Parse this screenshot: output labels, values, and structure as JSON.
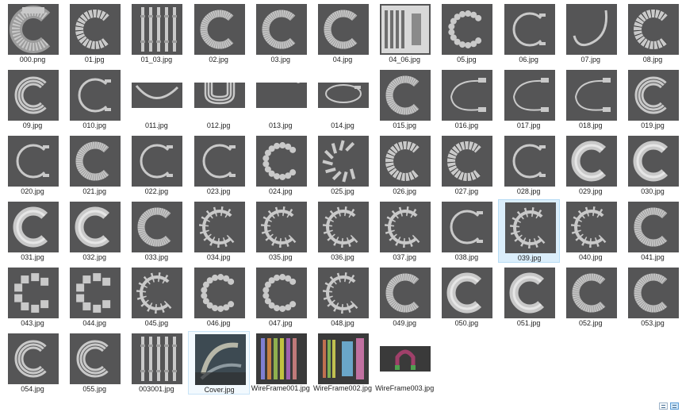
{
  "files": [
    {
      "name": "000.png",
      "icon": "cable-bundle-thumbnail",
      "shape": "bundle"
    },
    {
      "name": "01.jpg",
      "icon": "segmented-cable-thumbnail",
      "shape": "segments"
    },
    {
      "name": "01_03.jpg",
      "icon": "straight-cables-thumbnail",
      "shape": "straight"
    },
    {
      "name": "02.jpg",
      "icon": "ribbed-tube-thumbnail",
      "shape": "ribbed"
    },
    {
      "name": "03.jpg",
      "icon": "ribbed-tube-thumbnail",
      "shape": "ribbed"
    },
    {
      "name": "04.jpg",
      "icon": "ribbed-tube-thumbnail",
      "shape": "ribbed"
    },
    {
      "name": "04_06.jpg",
      "icon": "cable-sheet-thumbnail",
      "shape": "sheet"
    },
    {
      "name": "05.jpg",
      "icon": "bead-chain-thumbnail",
      "shape": "beads"
    },
    {
      "name": "06.jpg",
      "icon": "thin-wire-thumbnail",
      "shape": "wire"
    },
    {
      "name": "07.jpg",
      "icon": "curved-wire-thumbnail",
      "shape": "wirehook"
    },
    {
      "name": "08.jpg",
      "icon": "segmented-cable-thumbnail",
      "shape": "segments"
    },
    {
      "name": "09.jpg",
      "icon": "multi-tube-thumbnail",
      "shape": "multitube"
    },
    {
      "name": "010.jpg",
      "icon": "thin-wire-thumbnail",
      "shape": "wire"
    },
    {
      "name": "011.jpg",
      "icon": "thin-wire-thumbnail",
      "shape": "wide-wire"
    },
    {
      "name": "012.jpg",
      "icon": "multi-tube-thumbnail",
      "shape": "wide-multi"
    },
    {
      "name": "013.jpg",
      "icon": "bead-chain-thumbnail",
      "shape": "wide-beads"
    },
    {
      "name": "014.jpg",
      "icon": "wire-loop-thumbnail",
      "shape": "wide-loop"
    },
    {
      "name": "015.jpg",
      "icon": "ribbed-tube-thumbnail",
      "shape": "ribbed"
    },
    {
      "name": "016.jpg",
      "icon": "wire-loop-thumbnail",
      "shape": "loop"
    },
    {
      "name": "017.jpg",
      "icon": "wire-loop-thumbnail",
      "shape": "loop"
    },
    {
      "name": "018.jpg",
      "icon": "wire-loop-thumbnail",
      "shape": "loop"
    },
    {
      "name": "019.jpg",
      "icon": "multi-tube-thumbnail",
      "shape": "multitube"
    },
    {
      "name": "020.jpg",
      "icon": "thin-wire-thumbnail",
      "shape": "wire"
    },
    {
      "name": "021.jpg",
      "icon": "ribbed-tube-thumbnail",
      "shape": "ribbed"
    },
    {
      "name": "022.jpg",
      "icon": "thin-wire-thumbnail",
      "shape": "wire"
    },
    {
      "name": "023.jpg",
      "icon": "thin-wire-thumbnail",
      "shape": "wire"
    },
    {
      "name": "024.jpg",
      "icon": "bead-chain-thumbnail",
      "shape": "beads"
    },
    {
      "name": "025.jpg",
      "icon": "twisted-cable-thumbnail",
      "shape": "twisted"
    },
    {
      "name": "026.jpg",
      "icon": "segmented-cable-thumbnail",
      "shape": "segments"
    },
    {
      "name": "027.jpg",
      "icon": "segmented-cable-thumbnail",
      "shape": "segments"
    },
    {
      "name": "028.jpg",
      "icon": "thin-wire-thumbnail",
      "shape": "wire"
    },
    {
      "name": "029.jpg",
      "icon": "smooth-tube-thumbnail",
      "shape": "smooth"
    },
    {
      "name": "030.jpg",
      "icon": "smooth-tube-thumbnail",
      "shape": "smooth"
    },
    {
      "name": "031.jpg",
      "icon": "smooth-tube-thumbnail",
      "shape": "smooth"
    },
    {
      "name": "032.jpg",
      "icon": "smooth-tube-thumbnail",
      "shape": "smooth"
    },
    {
      "name": "033.jpg",
      "icon": "ribbed-tube-thumbnail",
      "shape": "ribbed"
    },
    {
      "name": "034.jpg",
      "icon": "framed-cable-thumbnail",
      "shape": "framed"
    },
    {
      "name": "035.jpg",
      "icon": "framed-cable-thumbnail",
      "shape": "framed"
    },
    {
      "name": "036.jpg",
      "icon": "framed-cable-thumbnail",
      "shape": "framed"
    },
    {
      "name": "037.jpg",
      "icon": "framed-cable-thumbnail",
      "shape": "framed"
    },
    {
      "name": "038.jpg",
      "icon": "thin-wire-thumbnail",
      "shape": "wire"
    },
    {
      "name": "039.jpg",
      "icon": "framed-cable-thumbnail",
      "shape": "framed",
      "selected": true
    },
    {
      "name": "040.jpg",
      "icon": "framed-cable-thumbnail",
      "shape": "framed"
    },
    {
      "name": "041.jpg",
      "icon": "ribbed-tube-thumbnail",
      "shape": "ribbed"
    },
    {
      "name": "043.jpg",
      "icon": "block-chain-thumbnail",
      "shape": "blocks"
    },
    {
      "name": "044.jpg",
      "icon": "block-chain-thumbnail",
      "shape": "blocks"
    },
    {
      "name": "045.jpg",
      "icon": "framed-cable-thumbnail",
      "shape": "framed"
    },
    {
      "name": "046.jpg",
      "icon": "bead-chain-thumbnail",
      "shape": "beads"
    },
    {
      "name": "047.jpg",
      "icon": "bead-chain-thumbnail",
      "shape": "beads"
    },
    {
      "name": "048.jpg",
      "icon": "framed-cable-thumbnail",
      "shape": "framed"
    },
    {
      "name": "049.jpg",
      "icon": "ribbed-tube-thumbnail",
      "shape": "ribbed"
    },
    {
      "name": "050.jpg",
      "icon": "smooth-tube-thumbnail",
      "shape": "smooth"
    },
    {
      "name": "051.jpg",
      "icon": "smooth-tube-thumbnail",
      "shape": "smooth"
    },
    {
      "name": "052.jpg",
      "icon": "ribbed-tube-thumbnail",
      "shape": "ribbed"
    },
    {
      "name": "053.jpg",
      "icon": "ribbed-tube-thumbnail",
      "shape": "ribbed"
    },
    {
      "name": "054.jpg",
      "icon": "multi-tube-thumbnail",
      "shape": "multitube"
    },
    {
      "name": "055.jpg",
      "icon": "multi-tube-thumbnail",
      "shape": "multitube"
    },
    {
      "name": "003001.jpg",
      "icon": "straight-cables-thumbnail",
      "shape": "straight"
    },
    {
      "name": "Cover.jpg",
      "icon": "cover-art-thumbnail",
      "shape": "cover",
      "focused": true
    },
    {
      "name": "WireFrame001.jpg",
      "icon": "wireframe-thumbnail",
      "shape": "wf1"
    },
    {
      "name": "WireFrame002.jpg",
      "icon": "wireframe-thumbnail",
      "shape": "wf2"
    },
    {
      "name": "WireFrame003.jpg",
      "icon": "wireframe-thumbnail",
      "shape": "wide-wf3"
    }
  ],
  "colors": {
    "thumb_bg": "#555556",
    "model": "#c9c9c9",
    "selection": "#dbeefb",
    "selection_border": "#b7dcf5"
  },
  "view_buttons": [
    {
      "icon": "details-view-icon"
    },
    {
      "icon": "large-icons-view-icon",
      "active": true
    }
  ]
}
